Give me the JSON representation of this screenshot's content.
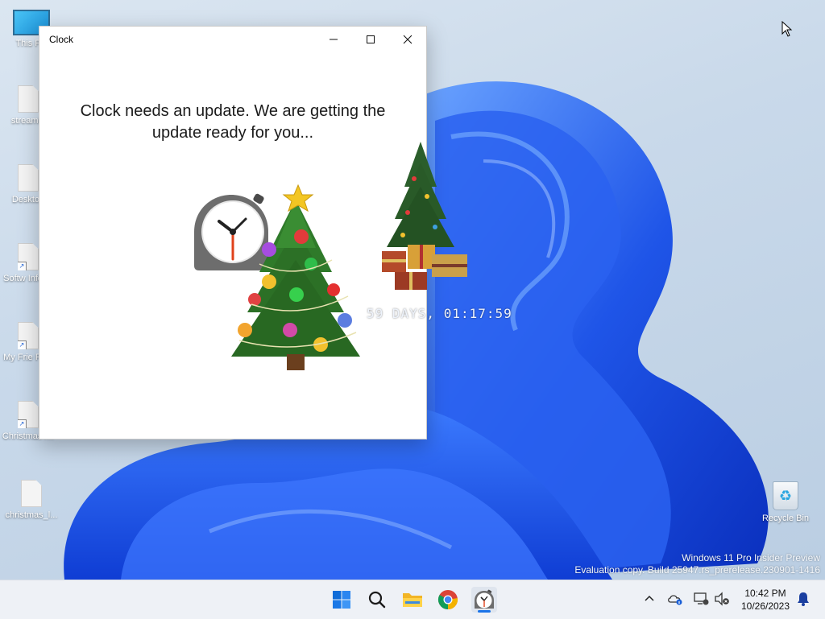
{
  "desktop": {
    "icons": [
      {
        "label": "This PC"
      },
      {
        "label": "streamin"
      },
      {
        "label": "Desktop"
      },
      {
        "label": "Softw Inform"
      },
      {
        "label": "My Frie Ping"
      },
      {
        "label": "ChristmasT..."
      },
      {
        "label": "christmas_l..."
      }
    ],
    "recycle_bin": {
      "label": "Recycle Bin"
    },
    "watermark": {
      "line1": "Windows 11 Pro Insider Preview",
      "line2": "Evaluation copy. Build 25947.rs_prerelease.230901-1416"
    }
  },
  "window": {
    "title": "Clock",
    "message": "Clock needs an update. We are getting the update ready for you...",
    "controls": {
      "minimize": "—",
      "maximize": "☐",
      "close": "✕"
    }
  },
  "overlay": {
    "countdown": "59 DAYS, 01:17:59"
  },
  "taskbar": {
    "apps": [
      {
        "name": "start",
        "icon": "windows-start-icon"
      },
      {
        "name": "search",
        "icon": "search-icon"
      },
      {
        "name": "file-explorer",
        "icon": "folder-icon"
      },
      {
        "name": "chrome",
        "icon": "chrome-icon"
      },
      {
        "name": "clock",
        "icon": "stopwatch-icon"
      }
    ],
    "clock": {
      "time": "10:42 PM",
      "date": "10/26/2023"
    }
  },
  "colors": {
    "accent": "#1a73e8",
    "wallpaper_blue": "#1f4fe0"
  }
}
